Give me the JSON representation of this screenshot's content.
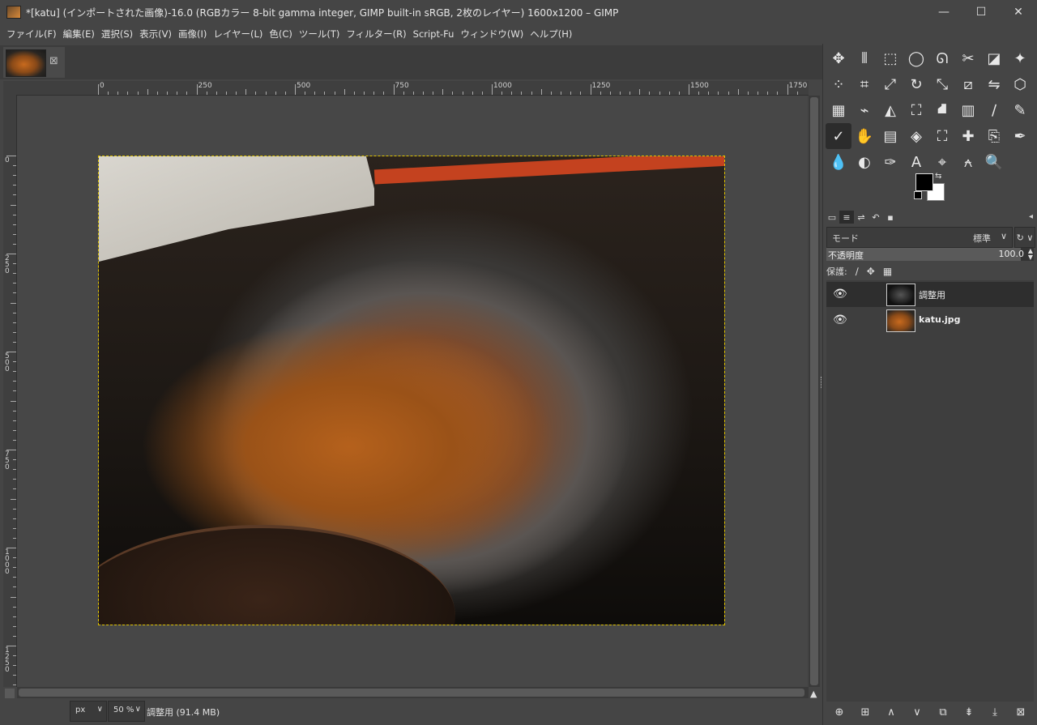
{
  "window": {
    "title": "*[katu] (インポートされた画像)-16.0 (RGBカラー 8-bit gamma integer, GIMP built-in sRGB, 2枚のレイヤー) 1600x1200 – GIMP",
    "minimize": "—",
    "maximize": "☐",
    "close": "✕"
  },
  "menu": [
    "ファイル(F)",
    "編集(E)",
    "選択(S)",
    "表示(V)",
    "画像(I)",
    "レイヤー(L)",
    "色(C)",
    "ツール(T)",
    "フィルター(R)",
    "Script-Fu",
    "ウィンドウ(W)",
    "ヘルプ(H)"
  ],
  "image_tab": {
    "close": "⊠"
  },
  "ruler_top": [
    "0",
    "250",
    "500",
    "750",
    "1000",
    "1250",
    "1500",
    "1750"
  ],
  "ruler_left": [
    "0",
    "250",
    "500",
    "750",
    "1000",
    "1250"
  ],
  "statusbar": {
    "unit": "px",
    "zoom": "50 %",
    "arrow": "∨",
    "text": "調整用 (91.4 MB)"
  },
  "toolbox": {
    "icons": [
      "move",
      "align",
      "rect-select",
      "ellipse-select",
      "free-select",
      "scissors-select",
      "foreground-select",
      "fuzzy-select",
      "by-color-select",
      "crop",
      "unified-transform",
      "rotate",
      "scale",
      "shear",
      "flip",
      "perspective",
      "3d-transform",
      "warp-transform",
      "handle-transform",
      "cage-transform",
      "bucket-fill",
      "gradient",
      "paintbrush",
      "pencil",
      "smudge-active",
      "airbrush",
      "mypaint-brush",
      "eraser",
      "clone",
      "heal",
      "perspective-clone",
      "ink",
      "blur",
      "dodge",
      "path",
      "text",
      "color-picker",
      "measure",
      "zoom",
      "empty"
    ],
    "glyphs": [
      "✥",
      "⫴",
      "⬚",
      "◯",
      "ᘏ",
      "✂",
      "◪",
      "✦",
      "⁘",
      "⌗",
      "⤢",
      "↻",
      "⤡",
      "⧄",
      "⇋",
      "⬡",
      "▦",
      "⌁",
      "◭",
      "⛶",
      "⛘",
      "▥",
      "∕",
      "✎",
      "✓",
      "✋",
      "▤",
      "◈",
      "⛶",
      "✚",
      "⎘",
      "✒",
      "💧",
      "◐",
      "✑",
      "A",
      "⌖",
      "⍲",
      "🔍",
      ""
    ],
    "fg_color": "#000000",
    "bg_color": "#ffffff"
  },
  "layers_dock": {
    "tabs": [
      "▭",
      "≡",
      "⇌",
      "↶",
      "▪"
    ],
    "menu_button": "◂",
    "mode_label": "モード",
    "mode_value": "標準",
    "mode_arrow": "∨",
    "composite": "↻ ∨",
    "opacity_label": "不透明度",
    "opacity_value": "100.0",
    "opacity_fraction": 1.0,
    "lock_label": "保護:",
    "lock_icons": [
      "∕",
      "✥",
      "▦"
    ],
    "layers": [
      {
        "name": "調整用",
        "eye": "👁",
        "selected": true
      },
      {
        "name": "katu.jpg",
        "eye": "👁",
        "selected": false
      }
    ],
    "buttons": [
      "⊕",
      "⊞",
      "∧",
      "∨",
      "⧉",
      "⇟",
      "⤓",
      "⊠"
    ]
  }
}
